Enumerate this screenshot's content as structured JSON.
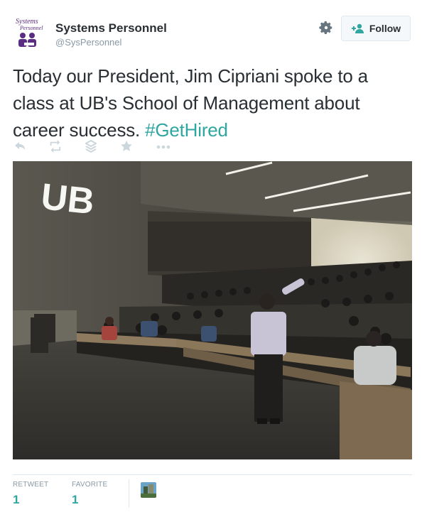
{
  "account": {
    "logo_text": "Systems Personnel",
    "name": "Systems Personnel",
    "handle": "@SysPersonnel"
  },
  "follow_button": {
    "label": "Follow"
  },
  "tweet": {
    "text": "Today our President, Jim Cipriani spoke to a class at UB's School of Management about career success.",
    "hashtag": "#GetHired"
  },
  "actions": [
    {
      "icon": "reply-icon"
    },
    {
      "icon": "retweet-icon"
    },
    {
      "icon": "stack-icon"
    },
    {
      "icon": "star-icon"
    },
    {
      "icon": "more-icon"
    }
  ],
  "photo": {
    "sign_text": "UB"
  },
  "stats": {
    "retweet_label": "RETWEET",
    "retweet_count": "1",
    "favorite_label": "FAVORITE",
    "favorite_count": "1"
  },
  "colors": {
    "hashtag": "#2fa6a0",
    "brand_purple": "#5a2d82"
  }
}
